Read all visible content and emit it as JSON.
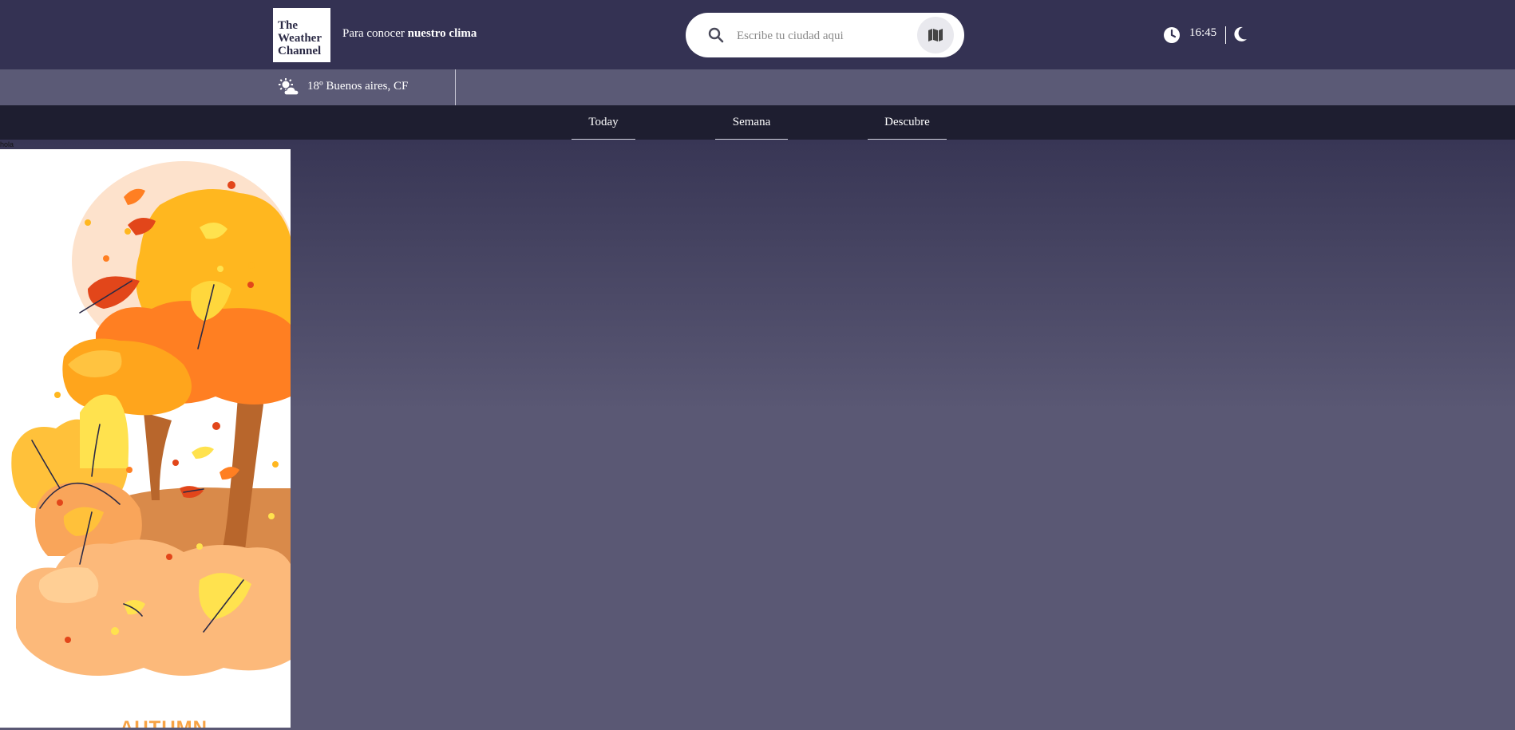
{
  "header": {
    "logo_lines": [
      "The",
      "Weather",
      "Channel"
    ],
    "tagline_prefix": "Para conocer ",
    "tagline_bold": "nuestro clima",
    "search_placeholder": "Escribe tu ciudad aqui",
    "search_icon": "search-icon",
    "map_icon": "map-icon",
    "clock_icon": "clock-icon",
    "time": "16:45",
    "theme_icon": "moon-icon"
  },
  "weather": {
    "icon": "sun-cloud-icon",
    "text": "18º Buenos aires, CF"
  },
  "nav": {
    "tabs": [
      {
        "label": "Today"
      },
      {
        "label": "Semana"
      },
      {
        "label": "Descubre"
      }
    ]
  },
  "main": {
    "debug_text": "hola",
    "poster_caption": "AUTUMN"
  },
  "colors": {
    "header_bg": "#343253",
    "weather_bar_bg": "#5b5a76",
    "nav_bg": "#1e1e30",
    "content_bg": "#5a5874"
  }
}
